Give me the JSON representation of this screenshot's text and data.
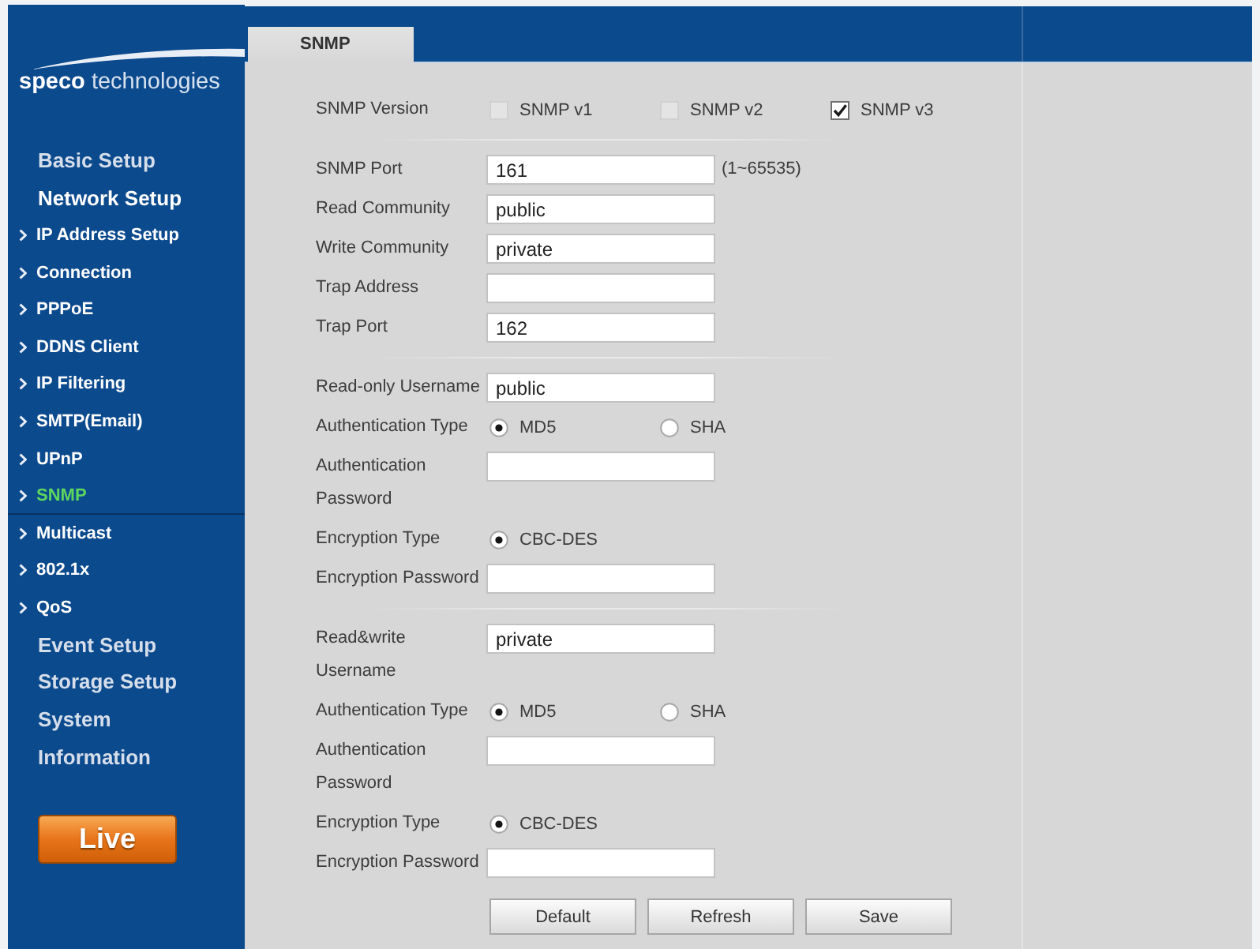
{
  "sidebar": {
    "logo": "**speco** technologies",
    "items": [
      {
        "label": "Basic Setup",
        "selected": false
      },
      {
        "label": "Network Setup",
        "selected": true,
        "children": [
          {
            "label": "IP Address Setup",
            "selected": false
          },
          {
            "label": "Connection",
            "selected": false
          },
          {
            "label": "PPPoE",
            "selected": false
          },
          {
            "label": "DDNS Client",
            "selected": false
          },
          {
            "label": "IP Filtering",
            "selected": false
          },
          {
            "label": "SMTP(Email)",
            "selected": false
          },
          {
            "label": "UPnP",
            "selected": false
          },
          {
            "label": "SNMP",
            "selected": true
          },
          {
            "label": "Multicast",
            "selected": false
          },
          {
            "label": "802.1x",
            "selected": false
          },
          {
            "label": "QoS",
            "selected": false
          }
        ]
      },
      {
        "label": "Event Setup",
        "selected": false
      },
      {
        "label": "Storage Setup",
        "selected": false
      },
      {
        "label": "System",
        "selected": false
      },
      {
        "label": "Information",
        "selected": false
      }
    ],
    "live_button": "Live"
  },
  "tabs": [
    {
      "label": "SNMP",
      "selected": true
    }
  ],
  "form": {
    "sections": [
      {
        "rows": [
          {
            "kind": "checkboxes",
            "label": "SNMP Version",
            "options": [
              {
                "label": "SNMP v1",
                "checked": false
              },
              {
                "label": "SNMP v2",
                "checked": false
              },
              {
                "label": "SNMP v3",
                "checked": true
              }
            ]
          }
        ]
      },
      {
        "rows": [
          {
            "kind": "field",
            "label": "SNMP Port",
            "value": "161",
            "hint": "(1~65535)"
          },
          {
            "kind": "field",
            "label": "Read Community",
            "value": "public"
          },
          {
            "kind": "field",
            "label": "Write Community",
            "value": "private"
          },
          {
            "kind": "field",
            "label": "Trap Address"
          },
          {
            "kind": "field",
            "label": "Trap Port",
            "value": "162"
          }
        ]
      },
      {
        "rows": [
          {
            "kind": "field",
            "label": "Read-only Username",
            "value": "public"
          },
          {
            "kind": "radios",
            "label": "Authentication Type",
            "options": [
              {
                "label": "MD5",
                "selected": true
              },
              {
                "label": "SHA",
                "selected": false
              }
            ]
          },
          {
            "kind": "field",
            "label": "Authentication Password"
          },
          {
            "kind": "radios",
            "label": "Encryption Type",
            "options": [
              {
                "label": "CBC-DES",
                "selected": true
              }
            ]
          },
          {
            "kind": "field",
            "label": "Encryption Password"
          }
        ]
      },
      {
        "rows": [
          {
            "kind": "field",
            "label": "Read&write Username",
            "value": "private"
          },
          {
            "kind": "radios",
            "label": "Authentication Type",
            "options": [
              {
                "label": "MD5",
                "selected": true
              },
              {
                "label": "SHA",
                "selected": false
              }
            ]
          },
          {
            "kind": "field",
            "label": "Authentication Password"
          },
          {
            "kind": "radios",
            "label": "Encryption Type",
            "options": [
              {
                "label": "CBC-DES",
                "selected": true
              }
            ]
          },
          {
            "kind": "field",
            "label": "Encryption Password"
          }
        ]
      }
    ]
  },
  "buttons": [
    "Default",
    "Refresh",
    "Save"
  ]
}
